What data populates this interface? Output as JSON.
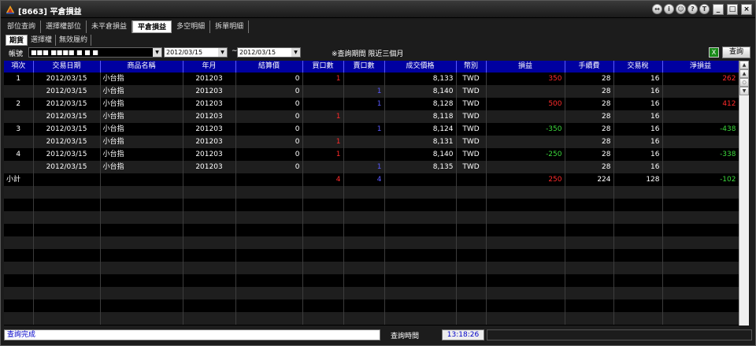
{
  "window": {
    "title": "[8663] 平倉損益"
  },
  "title_buttons": [
    "↔",
    "i",
    "☺",
    "?",
    "T"
  ],
  "window_controls": [
    "_",
    "□",
    "×"
  ],
  "tabs": [
    "部位查詢",
    "選擇權部位",
    "未平倉損益",
    "平倉損益",
    "多空明細",
    "拆單明細"
  ],
  "active_tab": 3,
  "subtabs": [
    "期貨",
    "選擇權",
    "無效履約"
  ],
  "active_subtab": 0,
  "filter": {
    "account_label": "帳號",
    "account_value": "■■■ ■■■■  ■ ■    ■",
    "date_from": "2012/03/15",
    "date_sep": "~",
    "date_to": "2012/03/15",
    "note": "※查詢期間 限近三個月",
    "excel_icon": "X",
    "query_button": "查詢"
  },
  "table": {
    "headers": [
      "項次",
      "交易日期",
      "商品名稱",
      "年月",
      "結算價",
      "買口數",
      "賣口數",
      "成交價格",
      "幣別",
      "損益",
      "手續費",
      "交易稅",
      "淨損益"
    ],
    "rows": [
      [
        "1",
        "2012/03/15",
        "小台指",
        "201203",
        "0",
        "1",
        "",
        "8,133",
        "TWD",
        "350",
        "28",
        "16",
        "262"
      ],
      [
        "",
        "2012/03/15",
        "小台指",
        "201203",
        "0",
        "",
        "1",
        "8,140",
        "TWD",
        "",
        "28",
        "16",
        ""
      ],
      [
        "2",
        "2012/03/15",
        "小台指",
        "201203",
        "0",
        "",
        "1",
        "8,128",
        "TWD",
        "500",
        "28",
        "16",
        "412"
      ],
      [
        "",
        "2012/03/15",
        "小台指",
        "201203",
        "0",
        "1",
        "",
        "8,118",
        "TWD",
        "",
        "28",
        "16",
        ""
      ],
      [
        "3",
        "2012/03/15",
        "小台指",
        "201203",
        "0",
        "",
        "1",
        "8,124",
        "TWD",
        "-350",
        "28",
        "16",
        "-438"
      ],
      [
        "",
        "2012/03/15",
        "小台指",
        "201203",
        "0",
        "1",
        "",
        "8,131",
        "TWD",
        "",
        "28",
        "16",
        ""
      ],
      [
        "4",
        "2012/03/15",
        "小台指",
        "201203",
        "0",
        "1",
        "",
        "8,140",
        "TWD",
        "-250",
        "28",
        "16",
        "-338"
      ],
      [
        "",
        "2012/03/15",
        "小台指",
        "201203",
        "0",
        "",
        "1",
        "8,135",
        "TWD",
        "",
        "28",
        "16",
        ""
      ],
      [
        "小計",
        "",
        "",
        "",
        "",
        "4",
        "4",
        "",
        "",
        "250",
        "224",
        "128",
        "-102"
      ]
    ],
    "empty_rows": 11
  },
  "scrollbar": [
    "▲",
    "▲",
    "○",
    "▼"
  ],
  "status": {
    "message": "查詢完成",
    "time_label": "查詢時間",
    "time_value": "13:18:26"
  },
  "colors": {
    "header_bg": "#0000a0",
    "buy": "#ff2a2a",
    "sell": "#5a5aff",
    "profit": "#ff2a2a",
    "loss": "#3cd83c"
  }
}
